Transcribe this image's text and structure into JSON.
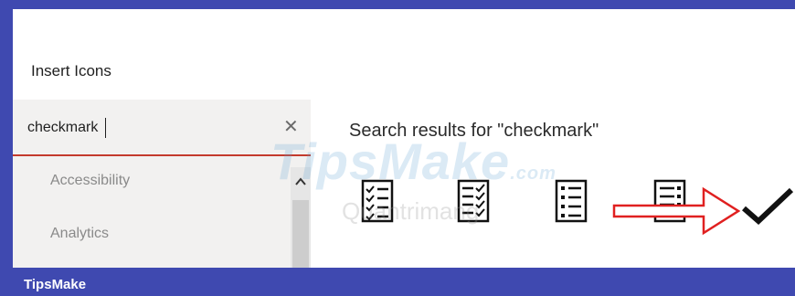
{
  "dialog": {
    "title": "Insert Icons"
  },
  "search": {
    "value": "checkmark",
    "clear_icon": "close-icon"
  },
  "categories": [
    "Accessibility",
    "Analytics"
  ],
  "results": {
    "title": "Search results for \"checkmark\"",
    "icons": [
      "checklist-icon",
      "checklist-icon",
      "bulleted-list-icon",
      "document-list-icon",
      "checkmark-icon"
    ]
  },
  "watermark": {
    "main": "TipsMake",
    "sub": ".com",
    "secondary": "Quantrimang"
  },
  "footer": {
    "brand": "TipsMake"
  },
  "colors": {
    "frame": "#3f49b0",
    "accent_underline": "#c43a2c",
    "arrow": "#e02020"
  }
}
